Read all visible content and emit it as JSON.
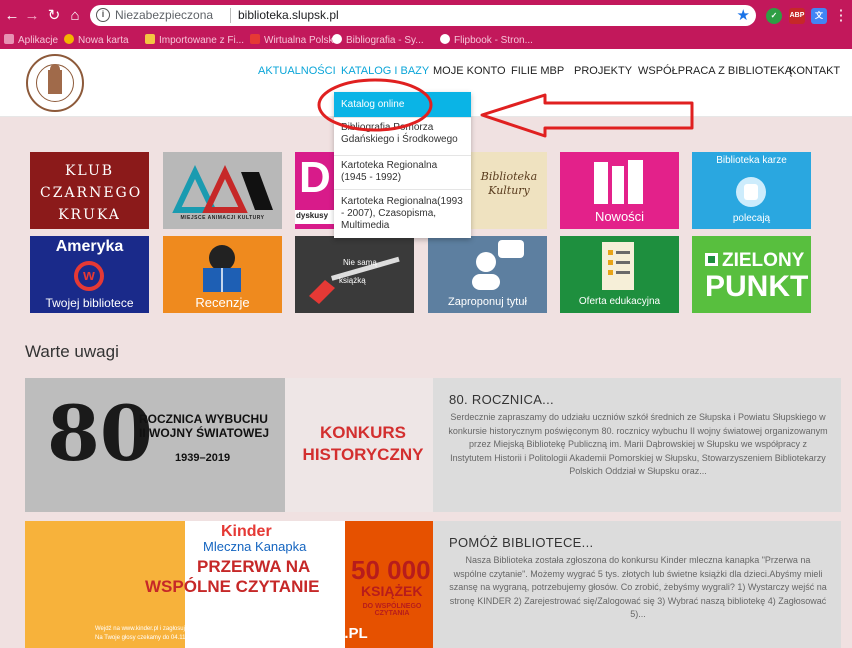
{
  "browser": {
    "insecure_label": "Niezabezpieczona",
    "url": "biblioteka.slupsk.pl",
    "extensions": [
      "ABP"
    ],
    "bookmarks": [
      "Aplikacje",
      "Nowa karta",
      "Importowane z Fi...",
      "Wirtualna Polska",
      "Bibliografia - Sy...",
      "Flipbook - Stron..."
    ]
  },
  "menu": {
    "items": [
      "AKTUALNOŚCI",
      "KATALOG I BAZY",
      "MOJE KONTO",
      "FILIE MBP",
      "PROJEKTY",
      "WSPÓŁPRACA Z BIBLIOTEKĄ",
      "KONTAKT"
    ],
    "dropdown": [
      "Katalog online",
      "Bibliografia Pomorza Gdańskiego i Środkowego",
      "Kartoteka Regionalna (1945 - 1992)",
      "Kartoteka Regionalna(1993 - 2007), Czasopisma, Multimedia"
    ]
  },
  "tiles": {
    "klub": "KLUB CZARNEGO KRUKA",
    "mak": "MAK",
    "mak_sub": "MIEJSCE ANIMACJI KULTURY",
    "dysk": "dyskusy",
    "biblioteka_kultury": "Biblioteka Kultury",
    "nowosci": "Nowości",
    "biblioteka_karze": "Biblioteka karze",
    "polecajac": "polecają",
    "ameryka": "Ameryka",
    "ameryka_sub": "Twojej bibliotece",
    "recenzje": "Recenzje",
    "nie_sama": "Nie samą",
    "ksiazka": "książką",
    "zaproponuj": "Zaproponuj tytuł",
    "oferta": "Oferta edukacyjna",
    "zielony": "ZIELONY",
    "punkt": "PUNKT"
  },
  "section": {
    "title": "Warte uwagi"
  },
  "cards": [
    {
      "title": "80. ROCZNICA...",
      "text": "Serdecznie zapraszamy do udziału uczniów szkół średnich ze Słupska i Powiatu Słupskiego w konkursie historycznym poświęconym 80. rocznicy wybuchu II wojny światowej organizowanym przez Miejską Bibliotekę Publiczną im. Marii Dąbrowskiej w Słupsku we współpracy z Instytutem Historii i Politologii Akademii Pomorskiej w Słupsku, Stowarzyszeniem Bibliotekarzy Polskich Oddział w Słupsku oraz...",
      "img_line1": "ROCZNICA WYBUCHU",
      "img_line2": "II WOJNY ŚWIATOWEJ",
      "img_years": "1939–2019",
      "img_red1": "KONKURS",
      "img_red2": "HISTORYCZNY"
    },
    {
      "title": "POMÓŻ BIBLIOTECE...",
      "text": "Nasza Biblioteka została zgłoszona do konkursu Kinder mleczna kanapka \"Przerwa na wspólne czytanie\". Możemy wygrać 5 tys. złotych lub świetne książki dla dzieci.Abyśmy mieli szansę na wygraną, potrzebujemy głosów. Co zrobić, żebyśmy wygrali? 1) Wystarczy wejść na stronę KINDER 2) Zarejestrować się/Zalogować się 3) Wybrać naszą bibliotekę 4) Zagłosować 5)...",
      "img_brand": "Kinder",
      "img_sub": "Mleczna Kanapka",
      "img_line1": "PRZERWA NA",
      "img_line2": "WSPÓLNE CZYTANIE",
      "img_big": "50 000",
      "img_big2": "KSIĄŻEK",
      "img_small": "DO WSPÓLNEGO CZYTANIA",
      "img_footer": "WWW.KINDER.PL",
      "img_note1": "Wejdź na www.kinder.pl i zagłosuj na bibliotekę!",
      "img_note2": "Na Twoje głosy czekamy do 04.11.2019r."
    }
  ],
  "colors": {
    "chrome": "#c2185b",
    "accent": "#0ab4e6",
    "annotation": "#e02020"
  }
}
